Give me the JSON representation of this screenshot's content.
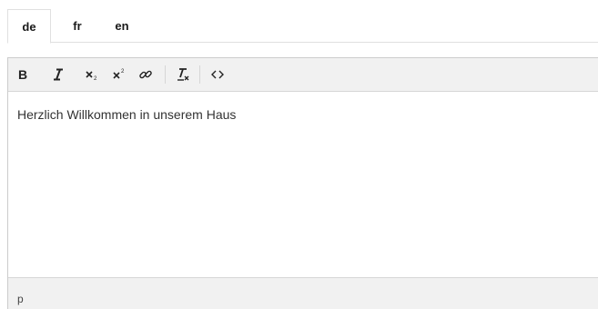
{
  "tabs": [
    {
      "label": "de",
      "active": true
    },
    {
      "label": "fr",
      "active": false
    },
    {
      "label": "en",
      "active": false
    }
  ],
  "toolbar": {
    "buttons": [
      {
        "name": "bold-icon"
      },
      {
        "name": "italic-icon"
      },
      {
        "name": "subscript-icon"
      },
      {
        "name": "superscript-icon"
      },
      {
        "name": "link-icon"
      },
      {
        "name": "remove-format-icon"
      },
      {
        "name": "source-code-icon"
      }
    ]
  },
  "editor": {
    "content": "Herzlich Willkommen in unserem Haus"
  },
  "statusbar": {
    "path": "p"
  },
  "colors": {
    "toolbar_bg": "#f1f1f1",
    "border": "#cccccc",
    "text": "#333333"
  }
}
